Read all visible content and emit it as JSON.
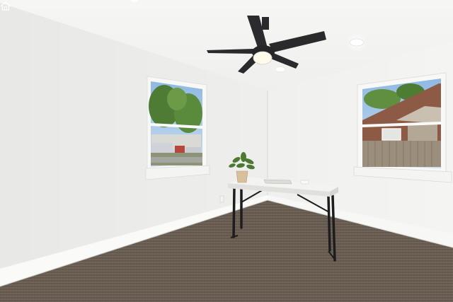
{
  "scene": {
    "subject": "empty room",
    "palette": {
      "ceiling": "#f4f4f2",
      "left_wall": "#ececea",
      "right_wall": "#f1f1ef",
      "baseboard": "#fafaf8",
      "carpet": "#6a5f56",
      "fan": "#2a2a2c",
      "fan_light": "#fffbea",
      "desk_top": "#f3f3f1",
      "desk_frame": "#1d1d1f",
      "sky": "#9ec3e6",
      "tree": "#4f7c35",
      "brick": "#8d5a45",
      "fence": "#9c8e7c"
    },
    "icons": [
      "ceiling-fan-icon",
      "plant-icon",
      "house-watermark-icon"
    ]
  }
}
